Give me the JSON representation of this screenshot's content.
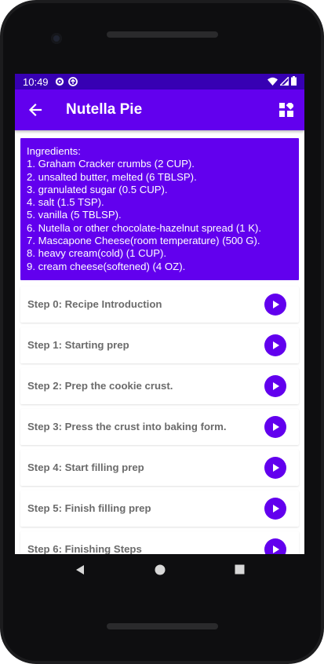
{
  "status_bar": {
    "time": "10:49",
    "left_icons": [
      "settings-icon",
      "sync-icon"
    ],
    "right_icons": [
      "wifi-icon",
      "signal-icon",
      "battery-icon"
    ]
  },
  "app_bar": {
    "title": "Nutella Pie",
    "back_icon": "arrow-left-icon",
    "action_icon": "dashboard-icon",
    "background": "#6200ee"
  },
  "ingredients": {
    "heading": "Ingredients:",
    "items": [
      "1. Graham Cracker crumbs (2 CUP).",
      "2. unsalted butter, melted (6 TBLSP).",
      "3. granulated sugar (0.5 CUP).",
      "4. salt (1.5 TSP).",
      "5. vanilla (5 TBLSP).",
      "6. Nutella or other chocolate-hazelnut spread (1 K).",
      "7. Mascapone Cheese(room temperature) (500 G).",
      "8. heavy cream(cold) (1 CUP).",
      "9. cream cheese(softened) (4 OZ)."
    ]
  },
  "steps": [
    {
      "label": "Step 0: Recipe Introduction"
    },
    {
      "label": "Step 1: Starting prep"
    },
    {
      "label": "Step 2: Prep the cookie crust."
    },
    {
      "label": "Step 3: Press the crust into baking form."
    },
    {
      "label": "Step 4: Start filling prep"
    },
    {
      "label": "Step 5: Finish filling prep"
    },
    {
      "label": "Step 6: Finishing Steps"
    }
  ],
  "colors": {
    "primary": "#6200ee",
    "primary_dark": "#3700b3",
    "step_text": "#6b6b6b"
  },
  "nav_bar": {
    "icons": [
      "back-triangle-icon",
      "home-circle-icon",
      "recents-square-icon"
    ]
  }
}
